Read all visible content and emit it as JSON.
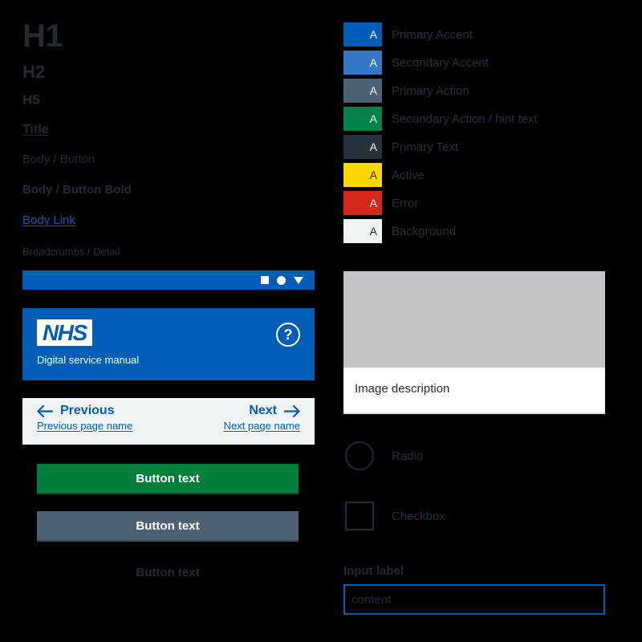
{
  "typography": {
    "items": [
      {
        "text": "H1",
        "style": "h1"
      },
      {
        "text": "H2",
        "style": "h2"
      },
      {
        "text": "H5",
        "style": "h5"
      },
      {
        "text": "Title",
        "style": "title"
      },
      {
        "text": "Body / Button",
        "style": "body"
      },
      {
        "text": "Body / Button Bold",
        "style": "body-bold"
      },
      {
        "text": "Body Link",
        "style": "body-link"
      },
      {
        "text": "Breadcrumbs / Detail",
        "style": "breadcrumb"
      }
    ]
  },
  "swatches": {
    "letter": "A",
    "items": [
      {
        "label": "Primary Accent",
        "color": "#005eb8",
        "letter_color": "#ffffff"
      },
      {
        "label": "Secondary Accent",
        "color": "#3478c6",
        "letter_color": "#ffffff"
      },
      {
        "label": "Primary Action",
        "color": "#4c6272",
        "letter_color": "#ffffff"
      },
      {
        "label": "Secondary Action / hint text",
        "color": "#00834a",
        "letter_color": "#ffffff"
      },
      {
        "label": "Primary Text",
        "color": "#27333c",
        "letter_color": "#ffffff"
      },
      {
        "label": "Active",
        "color": "#ffd700",
        "letter_color": "#212b32"
      },
      {
        "label": "Error",
        "color": "#d5281b",
        "letter_color": "#ffffff"
      },
      {
        "label": "Background",
        "color": "#f0f4f5",
        "letter_color": "#212b32"
      }
    ]
  },
  "blue_bar": {
    "icons": [
      "square-icon",
      "circle-icon",
      "triangle-down-icon"
    ]
  },
  "nhs_header": {
    "logo_text": "NHS",
    "subtitle": "Digital service manual",
    "help_glyph": "?",
    "background": "#005eb8"
  },
  "pagination": {
    "previous_label": "Previous",
    "previous_page_name": "Previous page name",
    "next_label": "Next",
    "next_page_name": "Next page name",
    "background": "#f0f4f5",
    "link_color": "#005eb8"
  },
  "buttons": [
    {
      "label": "Button text",
      "variant": "green"
    },
    {
      "label": "Button text",
      "variant": "grey"
    },
    {
      "label": "Button text",
      "variant": "plain"
    }
  ],
  "image_card": {
    "caption": "Image description",
    "placeholder_color": "#c2c4c6"
  },
  "controls": {
    "radio_label": "Radio",
    "checkbox_label": "Checkbox"
  },
  "input": {
    "label": "Input label",
    "value": "content",
    "placeholder": "content",
    "border_color": "#005eb8"
  }
}
